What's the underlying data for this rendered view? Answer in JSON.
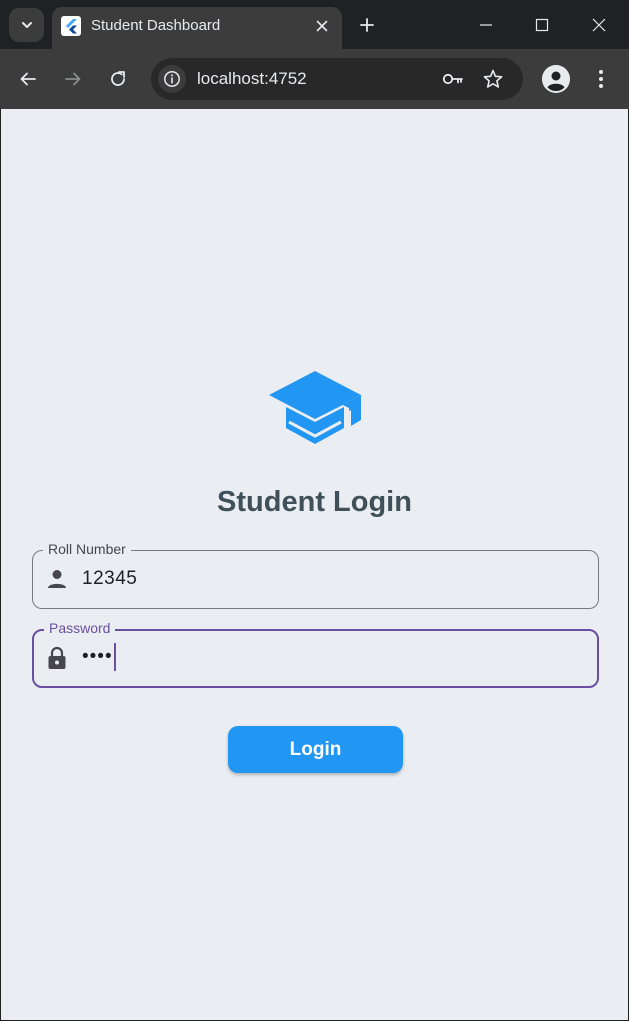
{
  "browser": {
    "tab_title": "Student Dashboard",
    "url": "localhost:4752"
  },
  "login": {
    "title": "Student Login",
    "roll_number": {
      "label": "Roll Number",
      "value": "12345"
    },
    "password": {
      "label": "Password",
      "value": "••••"
    },
    "button_label": "Login"
  },
  "colors": {
    "accent": "#2196f3",
    "focus_border": "#6b4fa0",
    "title_text": "#3f5058",
    "page_background": "#eaedf1"
  }
}
